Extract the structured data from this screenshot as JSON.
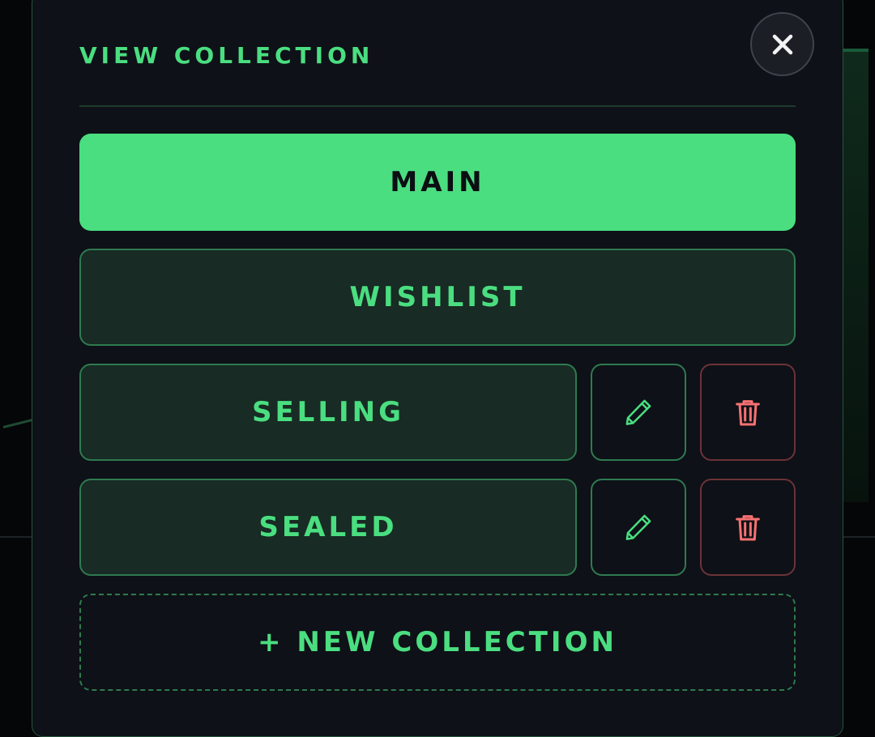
{
  "modal": {
    "title": "VIEW COLLECTION",
    "close_icon": "close-icon"
  },
  "collections": {
    "main": {
      "label": "MAIN",
      "selected": true
    },
    "wishlist": {
      "label": "WISHLIST"
    },
    "selling": {
      "label": "SELLING",
      "edit_icon": "pencil-icon",
      "delete_icon": "trash-icon"
    },
    "sealed": {
      "label": "SEALED",
      "edit_icon": "pencil-icon",
      "delete_icon": "trash-icon"
    }
  },
  "new_collection": {
    "label": "+ NEW COLLECTION"
  },
  "colors": {
    "accent": "#4ade80",
    "panel": "#0e1117",
    "collection_bg": "#182b24",
    "danger": "#f87171"
  }
}
